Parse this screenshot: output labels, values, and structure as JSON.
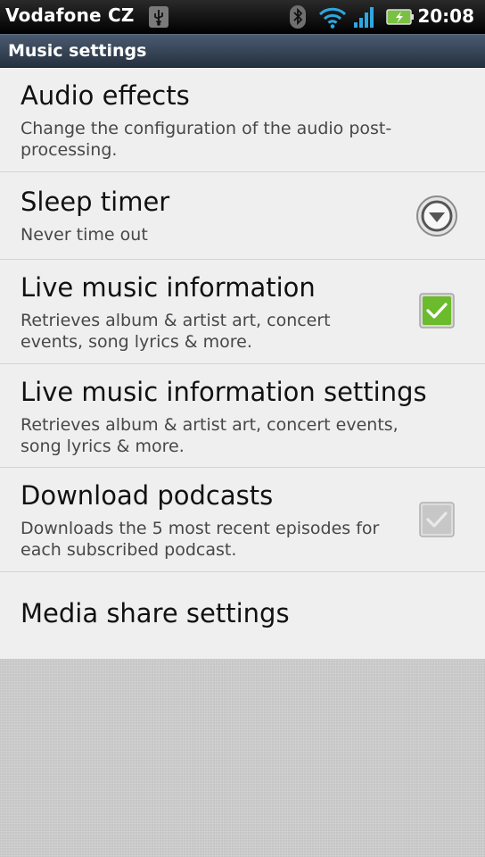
{
  "status_bar": {
    "carrier": "Vodafone CZ",
    "time": "20:08",
    "icons": [
      "usb-icon",
      "bluetooth-icon",
      "wifi-icon",
      "signal-icon",
      "battery-charging-icon"
    ]
  },
  "title_bar": {
    "title": "Music settings"
  },
  "settings": [
    {
      "title": "Audio effects",
      "summary": "Change the configuration of the audio post-processing."
    },
    {
      "title": "Sleep timer",
      "summary": "Never time out",
      "widget": "dropdown"
    },
    {
      "title": "Live music information",
      "summary": "Retrieves album & artist art, concert events, song lyrics & more.",
      "widget": "checkbox",
      "checked": true,
      "enabled": true
    },
    {
      "title": "Live music information settings",
      "summary": "Retrieves album & artist art, concert events, song lyrics & more."
    },
    {
      "title": "Download podcasts",
      "summary": "Downloads the 5 most recent episodes for each subscribed podcast.",
      "widget": "checkbox",
      "checked": true,
      "enabled": false
    },
    {
      "title": "Media share settings"
    }
  ],
  "colors": {
    "checkbox_checked": "#6cbb2c",
    "title_bar": "#3a4658",
    "list_background": "#efefef"
  }
}
